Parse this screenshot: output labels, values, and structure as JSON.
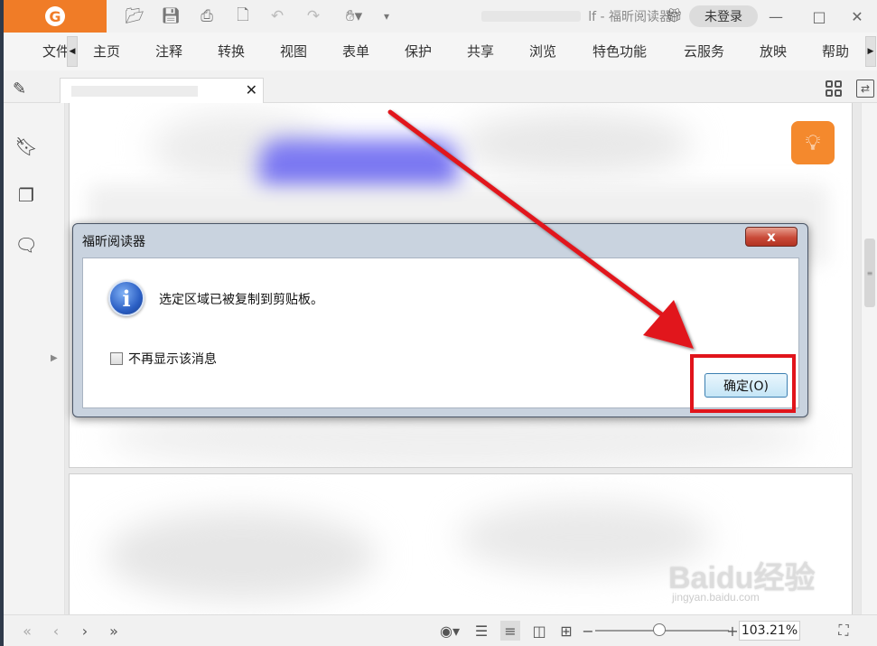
{
  "window": {
    "title_suffix": "lf - 福昕阅读器",
    "login": "未登录"
  },
  "menu": [
    "文件",
    "主页",
    "注释",
    "转换",
    "视图",
    "表单",
    "保护",
    "共享",
    "浏览",
    "特色功能",
    "云服务",
    "放映",
    "帮助"
  ],
  "dialog": {
    "title": "福昕阅读器",
    "close": "x",
    "message": "选定区域已被复制到剪贴板。",
    "checkbox_label": "不再显示该消息",
    "ok_label": "确定(O)"
  },
  "statusbar": {
    "zoom": "103.21%",
    "zoom_level": 0.48
  },
  "watermark": {
    "main": "Baidu经验",
    "sub": "jingyan.baidu.com"
  },
  "colors": {
    "brand": "#f07c27",
    "highlight": "#e1141b",
    "arrow": "#e1141b"
  }
}
